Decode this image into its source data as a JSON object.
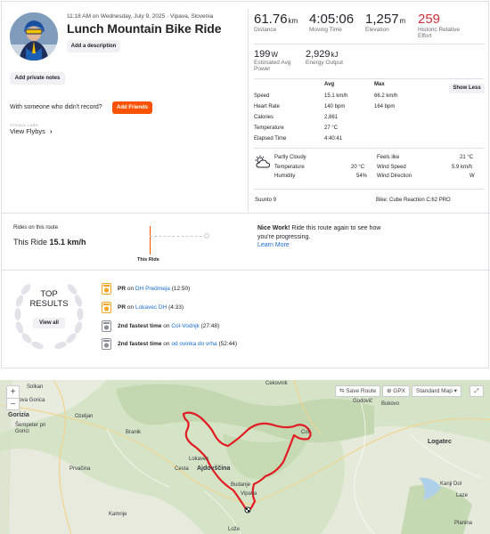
{
  "header": {
    "datetime": "11:18 AM on Wednesday, July 9, 2025 · Vipava, Slovenia",
    "title": "Lunch Mountain Bike Ride",
    "add_description": "Add a description",
    "add_notes": "Add private notes",
    "record_question": "With someone who didn't record?",
    "add_friends": "Add Friends",
    "labs": "STRAVA LABS",
    "view_flybys": "View Flybys"
  },
  "stats": {
    "distance": {
      "value": "61.76",
      "unit": "km",
      "label": "Distance"
    },
    "moving_time": {
      "value": "4:05:06",
      "label": "Moving Time"
    },
    "elevation": {
      "value": "1,257",
      "unit": "m",
      "label": "Elevation"
    },
    "relative_effort": {
      "value": "259",
      "label": "Historic Relative Effort"
    },
    "power": {
      "value": "199",
      "unit": "W",
      "label": "Estimated Avg Power"
    },
    "energy": {
      "value": "2,929",
      "unit": "kJ",
      "label": "Energy Output"
    }
  },
  "detail_table": {
    "col_avg": "Avg",
    "col_max": "Max",
    "show_less": "Show Less",
    "rows": [
      {
        "label": "Speed",
        "avg": "15.1 km/h",
        "max": "66.2 km/h"
      },
      {
        "label": "Heart Rate",
        "avg": "140 bpm",
        "max": "164 bpm"
      },
      {
        "label": "Calories",
        "avg": "2,861",
        "max": ""
      },
      {
        "label": "Temperature",
        "avg": "27 °C",
        "max": ""
      },
      {
        "label": "Elapsed Time",
        "avg": "4:40:41",
        "max": ""
      }
    ]
  },
  "weather": {
    "condition": "Partly Cloudy",
    "temperature_label": "Temperature",
    "temperature": "20 °C",
    "humidity_label": "Humidity",
    "humidity": "54%",
    "feels_like_label": "Feels like",
    "feels_like": "21 °C",
    "wind_speed_label": "Wind Speed",
    "wind_speed": "5.9 km/h",
    "wind_dir_label": "Wind Direction",
    "wind_dir": "W"
  },
  "device": "Suunto 9",
  "bike": "Bike: Cube Reaction C:62 PRO",
  "rides_on_route": {
    "heading": "Rides on this route",
    "this_ride_label": "This Ride",
    "this_ride_value": "15.1 km/h",
    "axis_label": "This Ride"
  },
  "nice_work": {
    "bold": "Nice Work!",
    "text": " Ride this route again to see how you're progressing.",
    "link": "Learn More"
  },
  "top_results": {
    "title_line1": "TOP",
    "title_line2": "RESULTS",
    "view_all": "View all",
    "items": [
      {
        "rank": "PR",
        "pre": " on ",
        "segment": "DH Predmeja",
        "time": "(12:50)",
        "medal_color": "#f5a623"
      },
      {
        "rank": "PR",
        "pre": " on ",
        "segment": "Lokavec DH",
        "time": "(4:33)",
        "medal_color": "#f5a623"
      },
      {
        "rank": "2nd fastest time",
        "pre": " on ",
        "segment": "Col-Vodnjk",
        "time": "(27:48)",
        "medal_color": "#8a8f99"
      },
      {
        "rank": "2nd fastest time",
        "pre": " on ",
        "segment": "od ovinka do vrha",
        "time": "(52:44)",
        "medal_color": "#8a8f99"
      }
    ]
  },
  "map": {
    "save_route": "Save Route",
    "gpx": "GPX",
    "style": "Standard Map",
    "towns": [
      "Solkan",
      "Nova Gorica",
      "Gorizia",
      "Šempeter pri Gorici",
      "Ozeljan",
      "Branik",
      "Prvačina",
      "Lokavec",
      "Cesta",
      "Ajdovščina",
      "Budanje",
      "Vipava",
      "Godovič",
      "Logatec",
      "Čekovnik",
      "Col",
      "Kanji Dol",
      "Planina",
      "Laze",
      "Lože",
      "Kamnje",
      "Bukovo"
    ]
  }
}
